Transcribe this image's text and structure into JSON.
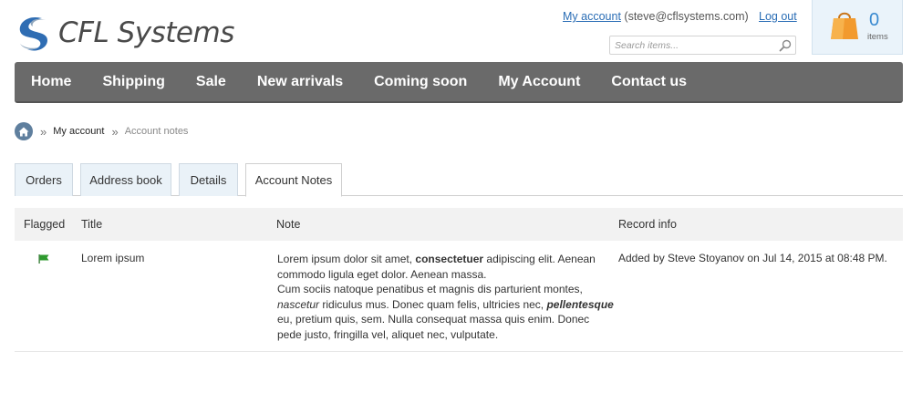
{
  "brand": {
    "name": "CFL Systems"
  },
  "account": {
    "link_label": "My account",
    "email": "(steve@cflsystems.com)",
    "logout_label": "Log out"
  },
  "search": {
    "placeholder": "Search items..."
  },
  "cart": {
    "count": "0",
    "label": "items"
  },
  "nav": {
    "items": [
      "Home",
      "Shipping",
      "Sale",
      "New arrivals",
      "Coming soon",
      "My Account",
      "Contact us"
    ]
  },
  "breadcrumb": {
    "items": [
      "My account",
      "Account notes"
    ]
  },
  "tabs": {
    "items": [
      "Orders",
      "Address book",
      "Details",
      "Account Notes"
    ],
    "active": "Account Notes"
  },
  "table": {
    "headers": [
      "Flagged",
      "Title",
      "Note",
      "Record info"
    ],
    "rows": [
      {
        "title": "Lorem ipsum",
        "note": {
          "p1_a": "Lorem ipsum dolor sit amet, ",
          "p1_bold": "consectetuer",
          "p1_b": " adipiscing elit. Aenean commodo ligula eget dolor. Aenean massa.",
          "p2_a": "Cum sociis natoque penatibus et magnis dis parturient montes, ",
          "p2_italic": "nascetur",
          "p2_b": " ridiculus mus. Donec quam felis, ultricies nec, ",
          "p2_bolditalic": "pellentesque",
          "p2_c": " eu, pretium quis, sem. Nulla consequat massa quis enim. Donec pede justo, fringilla vel, aliquet nec, vulputate."
        },
        "record_info": "Added by Steve Stoyanov on Jul 14, 2015 at 08:48 PM."
      }
    ]
  },
  "colors": {
    "nav_bg": "#6a6a6a",
    "link": "#2a6db5",
    "tab_bg": "#eaf2f8",
    "cart_bg": "#eaf3fa",
    "cart_count": "#3a8ad0",
    "flag": "#2e9a2e"
  },
  "icons": [
    "logo-swirl-icon",
    "search-icon",
    "shopping-bag-icon",
    "home-icon",
    "flag-icon"
  ]
}
